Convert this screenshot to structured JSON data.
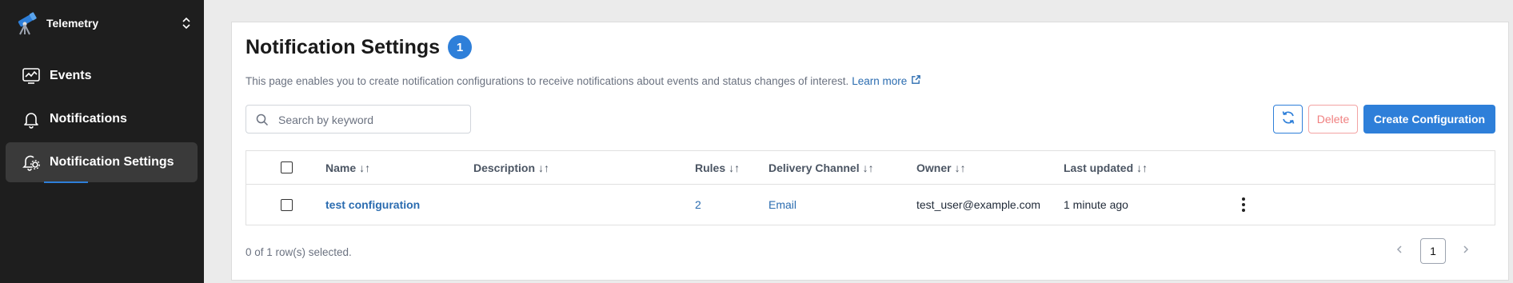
{
  "sidebar": {
    "app_name": "Telemetry",
    "items": [
      {
        "label": "Events",
        "icon": "chart-monitor-icon"
      },
      {
        "label": "Notifications",
        "icon": "bell-icon"
      },
      {
        "label": "Notification Settings",
        "icon": "bell-gear-icon",
        "active": true
      }
    ]
  },
  "header": {
    "title": "Notification Settings",
    "badge_count": "1",
    "description": "This page enables you to create notification configurations to receive notifications about events and status changes of interest.",
    "learn_more": "Learn more"
  },
  "toolbar": {
    "search_placeholder": "Search by keyword",
    "delete_label": "Delete",
    "create_label": "Create Configuration"
  },
  "table": {
    "columns": {
      "name": "Name",
      "description": "Description",
      "rules": "Rules",
      "delivery_channel": "Delivery Channel",
      "owner": "Owner",
      "last_updated": "Last updated"
    },
    "sort_glyph": "↓↑",
    "rows": [
      {
        "name": "test configuration",
        "description": "",
        "rules": "2",
        "delivery_channel": "Email",
        "owner": "test_user@example.com",
        "last_updated": "1 minute ago"
      }
    ]
  },
  "footer": {
    "selection_text": "0 of 1 row(s) selected.",
    "current_page": "1"
  },
  "colors": {
    "accent": "#2e7fd9",
    "sidebar_bg": "#1e1e1e",
    "delete_red": "#f08080"
  }
}
